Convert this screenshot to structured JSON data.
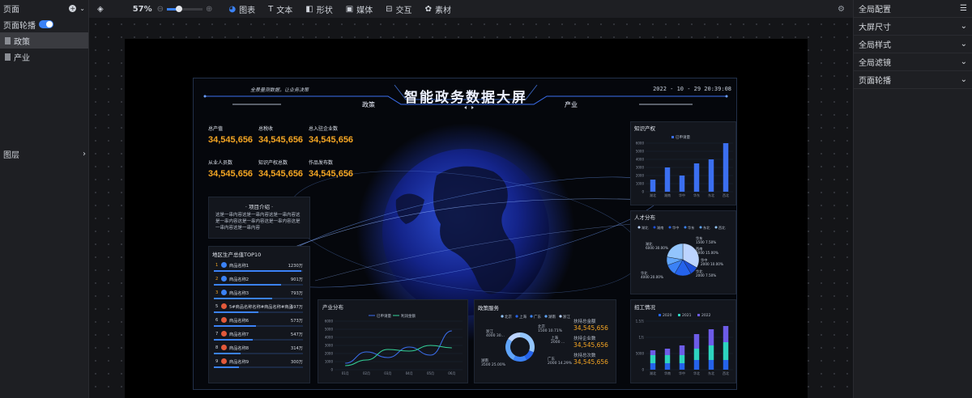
{
  "toolbar": {
    "zoom": "57%",
    "zoom_fraction": 0.35,
    "items": [
      "图表",
      "文本",
      "形状",
      "媒体",
      "交互",
      "素材"
    ]
  },
  "left_panel": {
    "title": "页面",
    "carousel_label": "页面轮播",
    "carousel_on": true,
    "pages": [
      "政策",
      "产业"
    ],
    "active_page": 0,
    "layers_label": "图层"
  },
  "right_panel": {
    "title": "全局配置",
    "sections": [
      "大屏尺寸",
      "全局样式",
      "全局滤镜",
      "页面轮播"
    ]
  },
  "screen": {
    "title": "智能政务数据大屏",
    "slogan": "全景量测数据，让业务决策",
    "datetime": "2022 - 10 - 29  20:39:08",
    "tab_left": "政策",
    "tab_right": "产业",
    "stats": [
      {
        "label": "总产值",
        "value": "34,545,656"
      },
      {
        "label": "总税收",
        "value": "34,545,656"
      },
      {
        "label": "总入驻企业数",
        "value": "34,545,656"
      },
      {
        "label": "从业人员数",
        "value": "34,545,656"
      },
      {
        "label": "知识产权总数",
        "value": "34,545,656"
      },
      {
        "label": "作品发布数",
        "value": "34,545,656"
      }
    ],
    "intro": {
      "title": "· 项目介绍 ·",
      "text": "这是一串内容这是一串内容这是一串内容这是一串内容这是一串内容这是一串内容这是一串内容这是一串内容"
    },
    "ranking": {
      "title": "地区生产总值TOP10",
      "rows": [
        {
          "num": "1",
          "name": "商品名称1",
          "value": "1230万",
          "frac": 0.98,
          "crown": true
        },
        {
          "num": "2",
          "name": "商品名称2",
          "value": "901万",
          "frac": 0.75,
          "crown": true
        },
        {
          "num": "3",
          "name": "商品名称3",
          "value": "793万",
          "frac": 0.65,
          "crown": true
        },
        {
          "num": "5",
          "name": "5#商品名称名称#商品名称#商品",
          "value": "597万",
          "frac": 0.5,
          "crown": false
        },
        {
          "num": "6",
          "name": "商品名称6",
          "value": "573万",
          "frac": 0.47,
          "crown": false
        },
        {
          "num": "7",
          "name": "商品名称7",
          "value": "547万",
          "frac": 0.44,
          "crown": false
        },
        {
          "num": "8",
          "name": "商品名称8",
          "value": "314万",
          "frac": 0.3,
          "crown": false
        },
        {
          "num": "9",
          "name": "商品名称9",
          "value": "300万",
          "frac": 0.28,
          "crown": false
        }
      ]
    },
    "policy": {
      "title": "政策服务",
      "legend": [
        "北京",
        "上海",
        "广东",
        "湖南",
        "浙江"
      ],
      "labels": [
        {
          "name": "浙江",
          "value": "4000 30..."
        },
        {
          "name": "北京",
          "value": "1500 10.71%"
        },
        {
          "name": "上海",
          "value": "2000 ..."
        },
        {
          "name": "湖南",
          "value": "3500 25.00%"
        },
        {
          "name": "广东",
          "value": "2000 14.29%"
        }
      ],
      "kpis": [
        {
          "label": "扶持总金额",
          "value": "34,545,656"
        },
        {
          "label": "扶持企业数",
          "value": "34,545,656"
        },
        {
          "label": "扶持总次数",
          "value": "34,545,656"
        }
      ]
    }
  },
  "chart_data": [
    {
      "type": "bar",
      "title": "知识产权",
      "legend": [
        "已申请量"
      ],
      "categories": [
        "湖北",
        "湖南",
        "华中",
        "华东",
        "东北",
        "西北"
      ],
      "values": [
        1500,
        3000,
        2000,
        3500,
        4000,
        6000
      ],
      "ylim": [
        0,
        6000
      ],
      "yticks": [
        "0",
        "1000",
        "2000",
        "3000",
        "4000",
        "5000",
        "6000"
      ],
      "color": "#3b6ff0"
    },
    {
      "type": "pie",
      "title": "人才分布",
      "legend": [
        "湖北",
        "湖南",
        "华中",
        "华东",
        "东北",
        "西北"
      ],
      "slices": [
        {
          "name": "湖北",
          "value": 6000,
          "label": "湖北\n6000 30.00%"
        },
        {
          "name": "华东",
          "value": 1500,
          "label": "华东\n1500 7.50%"
        },
        {
          "name": "西南",
          "value": 3000,
          "label": "西南\n3000 15.00%"
        },
        {
          "name": "华中",
          "value": 2000,
          "label": "华中\n2000 10.00%"
        },
        {
          "name": "华北",
          "value": 1500,
          "label": "华北\n2000 7.50%"
        },
        {
          "name": "华北",
          "value": 4000,
          "label": "华北\n4000 20.00%"
        }
      ],
      "colors": [
        "#bcd4ff",
        "#1d4fd8",
        "#2563eb",
        "#3b82f6",
        "#60a5fa",
        "#93c5fd"
      ]
    },
    {
      "type": "line",
      "title": "产业分布",
      "legend": [
        "已申请量",
        "利润金额"
      ],
      "categories": [
        "01月",
        "02月",
        "03月",
        "04月",
        "05月",
        "06月"
      ],
      "ylim": [
        0,
        6000
      ],
      "yticks": [
        "0",
        "1000",
        "2000",
        "3000",
        "4000",
        "5000",
        "6000"
      ],
      "series": [
        {
          "name": "已申请量",
          "values": [
            800,
            2200,
            1500,
            2800,
            1800,
            4800
          ],
          "color": "#3b6ff0"
        },
        {
          "name": "利润金额",
          "values": [
            500,
            1200,
            2500,
            2300,
            3000,
            2700
          ],
          "color": "#34d399"
        }
      ]
    },
    {
      "type": "bar",
      "title": "招工情况",
      "legend": [
        "2020",
        "2021",
        "2022"
      ],
      "categories": [
        "湖北",
        "华南",
        "华中",
        "华北",
        "东北",
        "西北"
      ],
      "yticks": [
        "0",
        "5000",
        "1万",
        "1.5万"
      ],
      "ylim": [
        0,
        15000
      ],
      "stacked": true,
      "series": [
        {
          "name": "2020",
          "values": [
            2000,
            2000,
            2000,
            3000,
            3000,
            3000
          ],
          "color": "#2563eb"
        },
        {
          "name": "2021",
          "values": [
            2500,
            2500,
            2500,
            3500,
            4500,
            5500
          ],
          "color": "#2dd4bf"
        },
        {
          "name": "2022",
          "values": [
            1500,
            2000,
            3000,
            4500,
            5000,
            5000
          ],
          "color": "#6d5ce8"
        }
      ]
    }
  ]
}
